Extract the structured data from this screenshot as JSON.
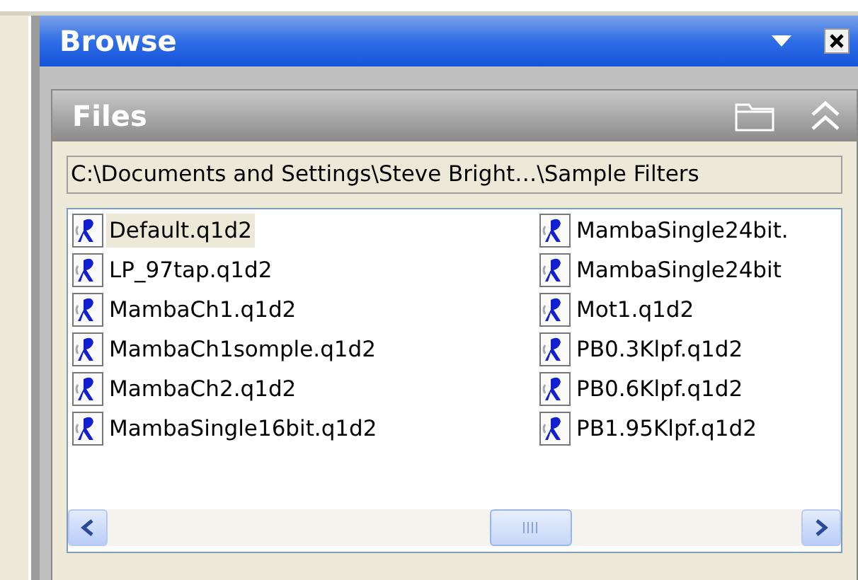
{
  "panel": {
    "title": "Browse"
  },
  "section": {
    "title": "Files",
    "expanded": true
  },
  "path": "C:\\Documents and Settings\\Steve Bright…\\Sample Filters",
  "files": [
    {
      "name": "Default.q1d2",
      "selected": true
    },
    {
      "name": "LP_97tap.q1d2",
      "selected": false
    },
    {
      "name": "MambaCh1.q1d2",
      "selected": false
    },
    {
      "name": "MambaCh1somple.q1d2",
      "selected": false
    },
    {
      "name": "MambaCh2.q1d2",
      "selected": false
    },
    {
      "name": "MambaSingle16bit.q1d2",
      "selected": false
    },
    {
      "name": "MambaSingle24bit.",
      "selected": false
    },
    {
      "name": "MambaSingle24bit",
      "selected": false
    },
    {
      "name": "Mot1.q1d2",
      "selected": false
    },
    {
      "name": "PB0.3Klpf.q1d2",
      "selected": false
    },
    {
      "name": "PB0.6Klpf.q1d2",
      "selected": false
    },
    {
      "name": "PB1.95Klpf.q1d2",
      "selected": false
    }
  ]
}
